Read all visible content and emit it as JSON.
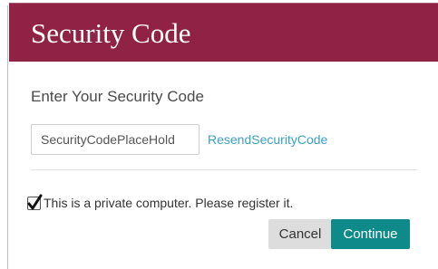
{
  "dialog": {
    "title": "Security Code",
    "subtitle": "Enter Your Security Code",
    "code_input": {
      "placeholder": "SecurityCodePlaceHold",
      "value": ""
    },
    "resend_link": "ResendSecurityCode",
    "private_computer": {
      "label": "This is a private computer. Please register it.",
      "checked": true
    },
    "buttons": {
      "cancel": "Cancel",
      "continue": "Continue"
    }
  },
  "colors": {
    "header_bg": "#8f2245",
    "primary_button": "#0e8a8a",
    "link": "#3da0c0",
    "secondary_button": "#dddddd"
  },
  "icons": {
    "checkbox_mark": "checkmark-icon"
  }
}
